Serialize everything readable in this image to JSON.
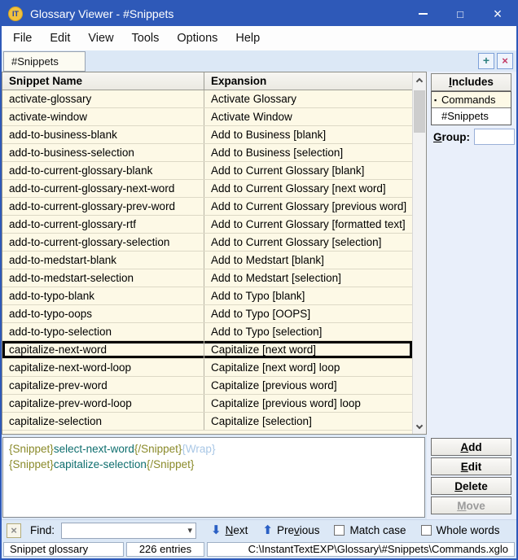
{
  "window": {
    "title": "Glossary Viewer - #Snippets",
    "icon_label": "IT"
  },
  "icons": {
    "minimize": "–",
    "maximize": "□",
    "close_win": "×",
    "plus": "+",
    "close": "×",
    "dropdown": "▾",
    "bullet": "▪",
    "arrow_down": "⬇",
    "arrow_up": "⬆",
    "find_close": "×"
  },
  "menu": {
    "items": [
      "File",
      "Edit",
      "View",
      "Tools",
      "Options",
      "Help"
    ]
  },
  "tabs": {
    "active_label": "#Snippets"
  },
  "table": {
    "columns": [
      "Snippet Name",
      "Expansion"
    ],
    "selected_index": 14,
    "rows": [
      {
        "name": "activate-glossary",
        "expansion": "Activate Glossary"
      },
      {
        "name": "activate-window",
        "expansion": "Activate Window"
      },
      {
        "name": "add-to-business-blank",
        "expansion": "Add to Business [blank]"
      },
      {
        "name": "add-to-business-selection",
        "expansion": "Add to Business [selection]"
      },
      {
        "name": "add-to-current-glossary-blank",
        "expansion": "Add to Current Glossary [blank]"
      },
      {
        "name": "add-to-current-glossary-next-word",
        "expansion": "Add to Current Glossary [next word]"
      },
      {
        "name": "add-to-current-glossary-prev-word",
        "expansion": "Add to Current Glossary [previous word]"
      },
      {
        "name": "add-to-current-glossary-rtf",
        "expansion": "Add to Current Glossary [formatted text]"
      },
      {
        "name": "add-to-current-glossary-selection",
        "expansion": "Add to Current Glossary [selection]"
      },
      {
        "name": "add-to-medstart-blank",
        "expansion": "Add to Medstart [blank]"
      },
      {
        "name": "add-to-medstart-selection",
        "expansion": "Add to Medstart [selection]"
      },
      {
        "name": "add-to-typo-blank",
        "expansion": "Add to Typo [blank]"
      },
      {
        "name": "add-to-typo-oops",
        "expansion": "Add to Typo [OOPS]"
      },
      {
        "name": "add-to-typo-selection",
        "expansion": "Add to Typo [selection]"
      },
      {
        "name": "capitalize-next-word",
        "expansion": "Capitalize [next word]"
      },
      {
        "name": "capitalize-next-word-loop",
        "expansion": "Capitalize [next word] loop"
      },
      {
        "name": "capitalize-prev-word",
        "expansion": "Capitalize [previous word]"
      },
      {
        "name": "capitalize-prev-word-loop",
        "expansion": "Capitalize [previous word] loop"
      },
      {
        "name": "capitalize-selection",
        "expansion": "Capitalize [selection]"
      }
    ]
  },
  "includes": {
    "title": {
      "text": "Includes",
      "u": 0
    },
    "items": [
      {
        "label": "Commands",
        "bullet": true,
        "style": "cream"
      },
      {
        "label": "#Snippets",
        "bullet": false,
        "style": "white"
      }
    ],
    "group_label": {
      "text": "Group:",
      "u": 0
    },
    "group_value": ""
  },
  "preview": {
    "lines": [
      {
        "segments": [
          {
            "text": "{Snippet}",
            "type": "tag"
          },
          {
            "text": "select-next-word",
            "type": "name"
          },
          {
            "text": "{/Snippet}",
            "type": "tag"
          },
          {
            "text": "{Wrap}",
            "type": "wrap"
          }
        ]
      },
      {
        "segments": [
          {
            "text": "{Snippet}",
            "type": "tag"
          },
          {
            "text": "capitalize-selection",
            "type": "name"
          },
          {
            "text": "{/Snippet}",
            "type": "tag"
          }
        ]
      }
    ]
  },
  "actions": {
    "add": {
      "text": "Add",
      "u": 0
    },
    "edit": {
      "text": "Edit",
      "u": 0
    },
    "delete": {
      "text": "Delete",
      "u": 0
    },
    "move": {
      "text": "Move",
      "u": 0
    }
  },
  "find": {
    "label": "Find:",
    "value": "",
    "next": {
      "text": "Next",
      "u": 0
    },
    "previous": {
      "text": "Previous",
      "u": 3
    },
    "match_case": "Match case",
    "whole_words": "Whole words"
  },
  "status": {
    "glossary_type": "Snippet glossary",
    "entries": "226 entries",
    "path": "C:\\InstantTextEXP\\Glossary\\#Snippets\\Commands.xglo"
  },
  "colors": {
    "titlebar": "#2e59b8",
    "chrome": "#dce8f6",
    "panel": "#e9effa",
    "row-cream": "#fdf9e6",
    "tag": "#8a8a2a",
    "sname": "#0e6e6e",
    "wrap": "#a9c7e6",
    "accent-arrow": "#2a5fc4",
    "plus": "#2e8080",
    "close-x": "#c23a64"
  }
}
